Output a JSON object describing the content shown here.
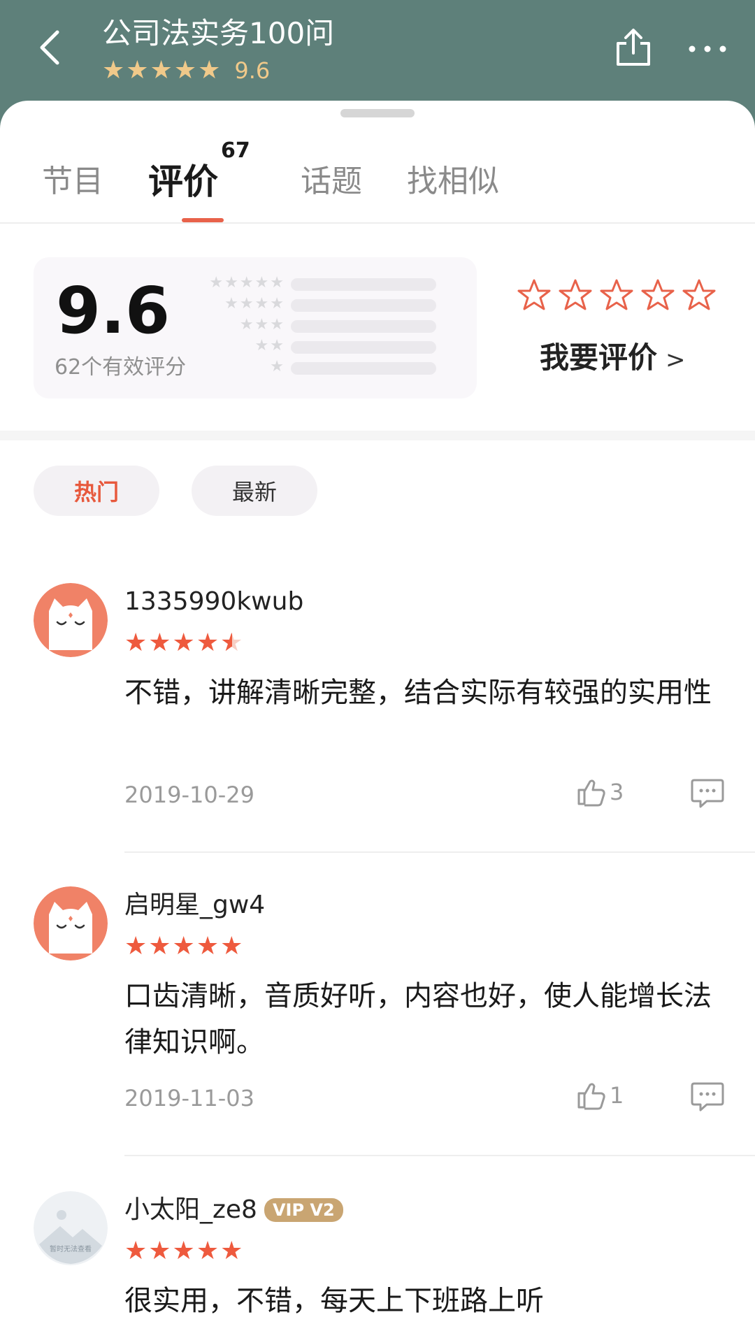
{
  "header": {
    "title": "公司法实务100问",
    "stars": "★★★★★",
    "score": "9.6"
  },
  "tabs": [
    {
      "label": "节目"
    },
    {
      "label": "评价",
      "count": "67"
    },
    {
      "label": "话题"
    },
    {
      "label": "找相似"
    }
  ],
  "summary": {
    "score": "9.6",
    "valid_count": "62个有效评分",
    "distribution_rows": [
      "★★★★★",
      "★★★★",
      "★★★",
      "★★",
      "★"
    ],
    "rate_action": "我要评价",
    "rate_chevron": ">"
  },
  "filters": [
    {
      "label": "热门",
      "active": true
    },
    {
      "label": "最新",
      "active": false
    }
  ],
  "reviews": [
    {
      "user": "1335990kwub",
      "rating": 4.5,
      "text": "不错，讲解清晰完整，结合实际有较强的实用性",
      "date": "2019-10-29",
      "likes": "3"
    },
    {
      "user": "启明星_gw4",
      "rating": 5,
      "text": "口齿清晰，音质好听，内容也好，使人能增长法律知识啊。",
      "date": "2019-11-03",
      "likes": "1"
    },
    {
      "user": "小太阳_ze8",
      "badge": "VIP V2",
      "avatar_caption": "暂时无法查看",
      "rating": 5,
      "text": "很实用，不错，每天上下班路上听"
    }
  ],
  "colors": {
    "header_bg": "#5e807a",
    "header_star": "#f0c98a",
    "accent": "#e8624a",
    "review_star": "#ee5a3e",
    "vip_badge": "#c9a572"
  },
  "icons": [
    "back-arrow-icon",
    "share-icon",
    "more-icon",
    "star-outline-icon",
    "thumbs-up-icon",
    "comment-icon"
  ]
}
